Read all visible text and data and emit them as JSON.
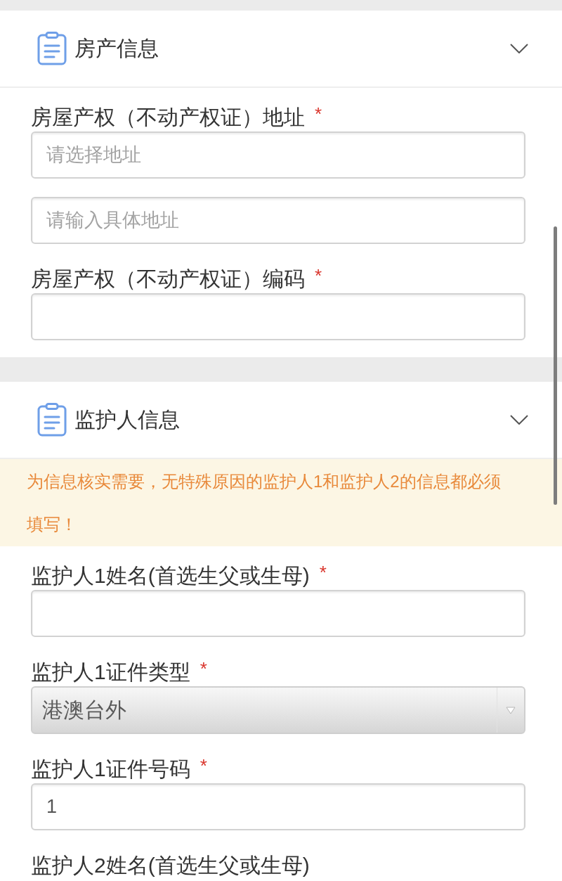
{
  "sections": [
    {
      "title": "房产信息",
      "fields": [
        {
          "label": "房屋产权（不动产权证）地址",
          "required_mark": "*",
          "inputs": [
            {
              "kind": "text",
              "placeholder": "请选择地址"
            },
            {
              "kind": "text",
              "placeholder": "请输入具体地址"
            }
          ]
        },
        {
          "label": "房屋产权（不动产权证）编码",
          "required_mark": "*",
          "inputs": [
            {
              "kind": "text"
            }
          ]
        }
      ]
    },
    {
      "title": "监护人信息",
      "notice": "为信息核实需要，无特殊原因的监护人1和监护人2的信息都必须填写！",
      "fields": [
        {
          "label": "监护人1姓名(首选生父或生母)",
          "required_mark": "*",
          "inputs": [
            {
              "kind": "text"
            }
          ]
        },
        {
          "label": "监护人1证件类型",
          "required_mark": "*",
          "inputs": [
            {
              "kind": "select",
              "value": "港澳台外"
            }
          ]
        },
        {
          "label": "监护人1证件号码",
          "required_mark": "*",
          "inputs": [
            {
              "kind": "text",
              "value": "1"
            }
          ]
        },
        {
          "label": "监护人2姓名(首选生父或生母)"
        }
      ]
    }
  ]
}
